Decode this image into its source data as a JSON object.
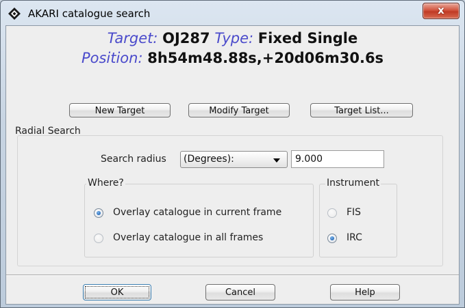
{
  "window": {
    "title": "AKARI catalogue search",
    "close_label": "x"
  },
  "target": {
    "target_label": "Target:",
    "target_value": "OJ287",
    "type_label": "Type:",
    "type_value": "Fixed Single",
    "position_label": "Position:",
    "position_value": "8h54m48.88s,+20d06m30.6s"
  },
  "target_buttons": {
    "new": "New Target",
    "modify": "Modify Target",
    "list": "Target List..."
  },
  "radial_search": {
    "title": "Radial Search",
    "radius_label": "Search radius",
    "units_selected": "(Degrees):",
    "radius_value": "9.000"
  },
  "where": {
    "title": "Where?",
    "options": [
      {
        "label": "Overlay catalogue in current frame",
        "checked": true
      },
      {
        "label": "Overlay catalogue in all frames",
        "checked": false
      }
    ]
  },
  "instrument": {
    "title": "Instrument",
    "options": [
      {
        "label": "FIS",
        "checked": false
      },
      {
        "label": "IRC",
        "checked": true
      }
    ]
  },
  "dialog_buttons": {
    "ok": "OK",
    "cancel": "Cancel",
    "help": "Help"
  }
}
